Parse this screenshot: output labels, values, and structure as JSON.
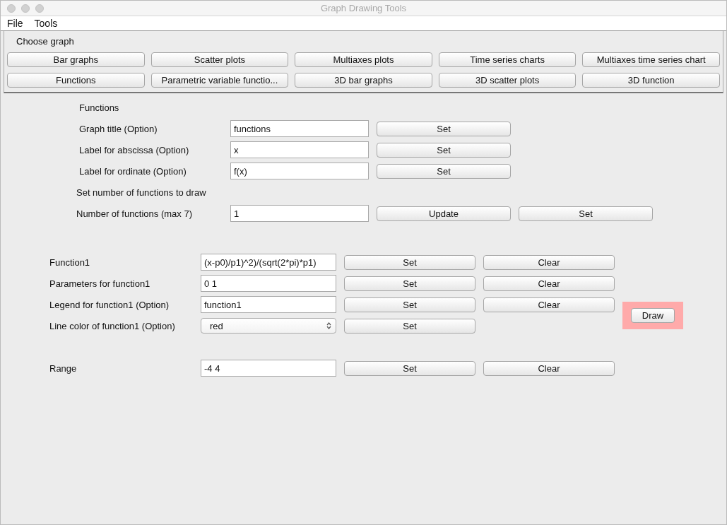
{
  "window": {
    "title": "Graph Drawing Tools"
  },
  "menu": [
    "File",
    "Tools"
  ],
  "chooser": {
    "label": "Choose graph",
    "buttons": [
      "Bar graphs",
      "Scatter plots",
      "Multiaxes plots",
      "Time series charts",
      "Multiaxes time series chart",
      "Functions",
      "Parametric variable functio...",
      "3D bar graphs",
      "3D scatter plots",
      "3D function"
    ]
  },
  "settings": {
    "heading": "Functions",
    "rows": [
      {
        "label": "Graph title (Option)",
        "value": "functions",
        "buttons": [
          "Set"
        ]
      },
      {
        "label": "Label for abscissa (Option)",
        "value": "x",
        "buttons": [
          "Set"
        ]
      },
      {
        "label": "Label for ordinate (Option)",
        "value": "f(x)",
        "buttons": [
          "Set"
        ]
      }
    ]
  },
  "count": {
    "heading": "Set number of functions to draw",
    "label": "Number of functions (max 7)",
    "value": "1",
    "buttons": [
      "Update",
      "Set"
    ]
  },
  "functions": {
    "rows": [
      {
        "kind": "text",
        "label": "Function1",
        "value": "(x-p0)/p1)^2)/(sqrt(2*pi)*p1)",
        "buttons": [
          "Set",
          "Clear"
        ]
      },
      {
        "kind": "text",
        "label": "Parameters for function1",
        "value": "0 1",
        "buttons": [
          "Set",
          "Clear"
        ]
      },
      {
        "kind": "text",
        "label": "Legend for function1 (Option)",
        "value": "function1",
        "buttons": [
          "Set",
          "Clear"
        ]
      },
      {
        "kind": "select",
        "label": "Line color of function1 (Option)",
        "value": "red",
        "buttons": [
          "Set"
        ]
      }
    ],
    "draw_button": {
      "label": "Draw",
      "highlighted": true
    }
  },
  "range": {
    "label": "Range",
    "value": "-4 4",
    "buttons": [
      "Set",
      "Clear"
    ]
  }
}
